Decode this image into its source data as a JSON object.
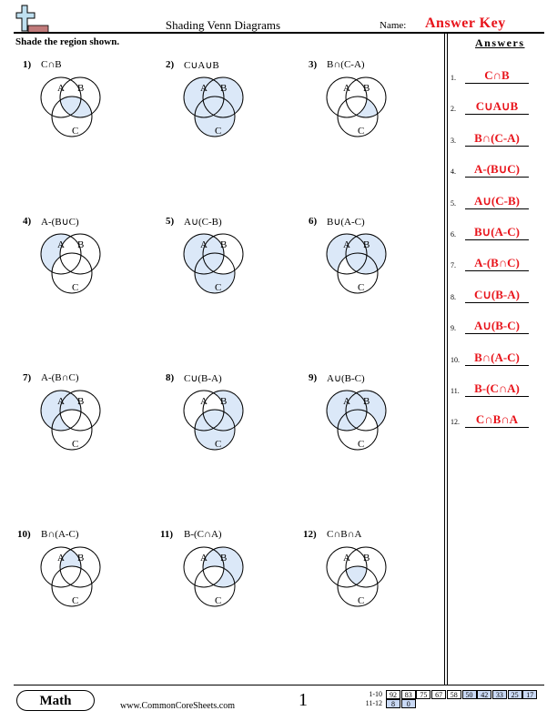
{
  "header": {
    "title": "Shading Venn Diagrams",
    "name_label": "Name:",
    "name_value": "Answer Key",
    "instructions": "Shade the region shown."
  },
  "colors": {
    "shade": "#dbe8f8",
    "answer": "#e8141b",
    "score_highlight": "#c9d9f5"
  },
  "venn_labels": {
    "a": "A",
    "b": "B",
    "c": "C"
  },
  "problems": [
    {
      "num": "1)",
      "expr": "C∩B",
      "shaded": [
        "bc",
        "abc"
      ]
    },
    {
      "num": "2)",
      "expr": "C∪A∪B",
      "shaded": [
        "a",
        "b",
        "c",
        "ab",
        "ac",
        "bc",
        "abc"
      ]
    },
    {
      "num": "3)",
      "expr": "B∩(C-A)",
      "shaded": [
        "bc"
      ]
    },
    {
      "num": "4)",
      "expr": "A-(B∪C)",
      "shaded": [
        "a"
      ]
    },
    {
      "num": "5)",
      "expr": "A∪(C-B)",
      "shaded": [
        "a",
        "ab",
        "ac",
        "abc",
        "c"
      ]
    },
    {
      "num": "6)",
      "expr": "B∪(A-C)",
      "shaded": [
        "a",
        "b",
        "ab",
        "bc",
        "abc"
      ]
    },
    {
      "num": "7)",
      "expr": "A-(B∩C)",
      "shaded": [
        "a",
        "ab",
        "ac"
      ]
    },
    {
      "num": "8)",
      "expr": "C∪(B-A)",
      "shaded": [
        "b",
        "c",
        "ac",
        "bc",
        "abc"
      ]
    },
    {
      "num": "9)",
      "expr": "A∪(B-C)",
      "shaded": [
        "a",
        "b",
        "ab",
        "ac",
        "abc"
      ]
    },
    {
      "num": "10)",
      "expr": "B∩(A-C)",
      "shaded": [
        "ab"
      ]
    },
    {
      "num": "11)",
      "expr": "B-(C∩A)",
      "shaded": [
        "b",
        "ab",
        "bc"
      ]
    },
    {
      "num": "12)",
      "expr": "C∩B∩A",
      "shaded": [
        "abc"
      ]
    }
  ],
  "answers": {
    "heading": "Answers",
    "items": [
      {
        "num": "1.",
        "text": "C∩B"
      },
      {
        "num": "2.",
        "text": "C∪A∪B"
      },
      {
        "num": "3.",
        "text": "B∩(C-A)"
      },
      {
        "num": "4.",
        "text": "A-(B∪C)"
      },
      {
        "num": "5.",
        "text": "A∪(C-B)"
      },
      {
        "num": "6.",
        "text": "B∪(A-C)"
      },
      {
        "num": "7.",
        "text": "A-(B∩C)"
      },
      {
        "num": "8.",
        "text": "C∪(B-A)"
      },
      {
        "num": "9.",
        "text": "A∪(B-C)"
      },
      {
        "num": "10.",
        "text": "B∩(A-C)"
      },
      {
        "num": "11.",
        "text": "B-(C∩A)"
      },
      {
        "num": "12.",
        "text": "C∩B∩A"
      }
    ]
  },
  "footer": {
    "subject": "Math",
    "url": "www.CommonCoreSheets.com",
    "page": "1",
    "score_rows": [
      {
        "label": "1-10",
        "cells": [
          {
            "v": "92",
            "hl": false
          },
          {
            "v": "83",
            "hl": false
          },
          {
            "v": "75",
            "hl": false
          },
          {
            "v": "67",
            "hl": false
          },
          {
            "v": "58",
            "hl": false
          },
          {
            "v": "50",
            "hl": true
          },
          {
            "v": "42",
            "hl": true
          },
          {
            "v": "33",
            "hl": true
          },
          {
            "v": "25",
            "hl": true
          },
          {
            "v": "17",
            "hl": true
          }
        ]
      },
      {
        "label": "11-12",
        "cells": [
          {
            "v": "8",
            "hl": true
          },
          {
            "v": "0",
            "hl": true
          }
        ]
      }
    ]
  }
}
